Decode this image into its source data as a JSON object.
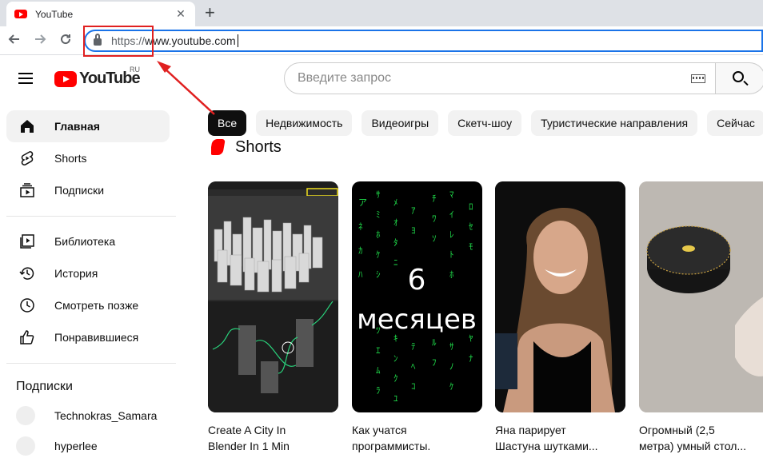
{
  "browser": {
    "tab_title": "YouTube",
    "tab_close": "✕",
    "new_tab": "+",
    "url_proto": "https://",
    "url_host": "www.youtube.com"
  },
  "header": {
    "logo_text": "YouTube",
    "region": "RU",
    "search_placeholder": "Введите запрос"
  },
  "sidebar": {
    "items": [
      {
        "label": "Главная",
        "icon": "home-icon"
      },
      {
        "label": "Shorts",
        "icon": "shorts-icon"
      },
      {
        "label": "Подписки",
        "icon": "subscriptions-icon"
      },
      {
        "label": "Библиотека",
        "icon": "library-icon"
      },
      {
        "label": "История",
        "icon": "history-icon"
      },
      {
        "label": "Смотреть позже",
        "icon": "clock-icon"
      },
      {
        "label": "Понравившиеся",
        "icon": "thumbs-up-icon"
      }
    ],
    "subs_heading": "Подписки",
    "channels": [
      "Technokras_Samara",
      "hyperlee"
    ]
  },
  "chips": [
    "Все",
    "Недвижимость",
    "Видеоигры",
    "Скетч-шоу",
    "Туристические направления",
    "Сейчас"
  ],
  "shorts": {
    "title": "Shorts",
    "items": [
      {
        "title_l1": "Create A City In",
        "title_l2": "Blender In 1 Min"
      },
      {
        "title_l1": "Как учатся",
        "title_l2": "программисты.",
        "overlay_l1": "6",
        "overlay_l2": "месяцев"
      },
      {
        "title_l1": "Яна парирует",
        "title_l2": "Шастуна шутками..."
      },
      {
        "title_l1": "Огромный (2,5",
        "title_l2": "метра) умный стол..."
      }
    ]
  },
  "colors": {
    "brand_red": "#ff0000",
    "annotation_red": "#e02020",
    "focus_blue": "#1a73e8"
  }
}
